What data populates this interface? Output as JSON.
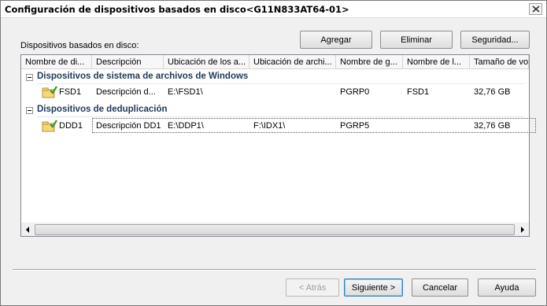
{
  "window": {
    "title": "Configuración de dispositivos basados en disco<G11N833AT64-01>"
  },
  "section_label": "Dispositivos basados en disco:",
  "toolbar": {
    "add_label": "Agregar",
    "delete_label": "Eliminar",
    "security_label": "Seguridad..."
  },
  "columns": [
    "Nombre de di...",
    "Descripción",
    "Ubicación de los a...",
    "Ubicación de archi...",
    "Nombre de g...",
    "Nombre de l...",
    "Tamaño de vol..."
  ],
  "groups": [
    {
      "label": "Dispositivos de sistema de archivos de Windows",
      "rows": [
        {
          "name": "FSD1",
          "description": "Descripción d...",
          "location": "E:\\FSD1\\",
          "index_location": "",
          "group_name": "PGRP0",
          "l_name": "FSD1",
          "size": "32,76 GB"
        }
      ]
    },
    {
      "label": "Dispositivos de deduplicación",
      "rows": [
        {
          "name": "DDD1",
          "description": "Descripción DD1",
          "location": "E:\\DDP1\\",
          "index_location": "F:\\IDX1\\",
          "group_name": "PGRP5",
          "l_name": "",
          "size": "32,76 GB"
        }
      ]
    }
  ],
  "footer": {
    "back_label": "< Atrás",
    "next_label": "Siguiente >",
    "cancel_label": "Cancelar",
    "help_label": "Ayuda"
  },
  "colors": {
    "group_text": "#1e395b",
    "window_bg": "#f0f0f0",
    "default_button_border": "#3c7fb1"
  }
}
